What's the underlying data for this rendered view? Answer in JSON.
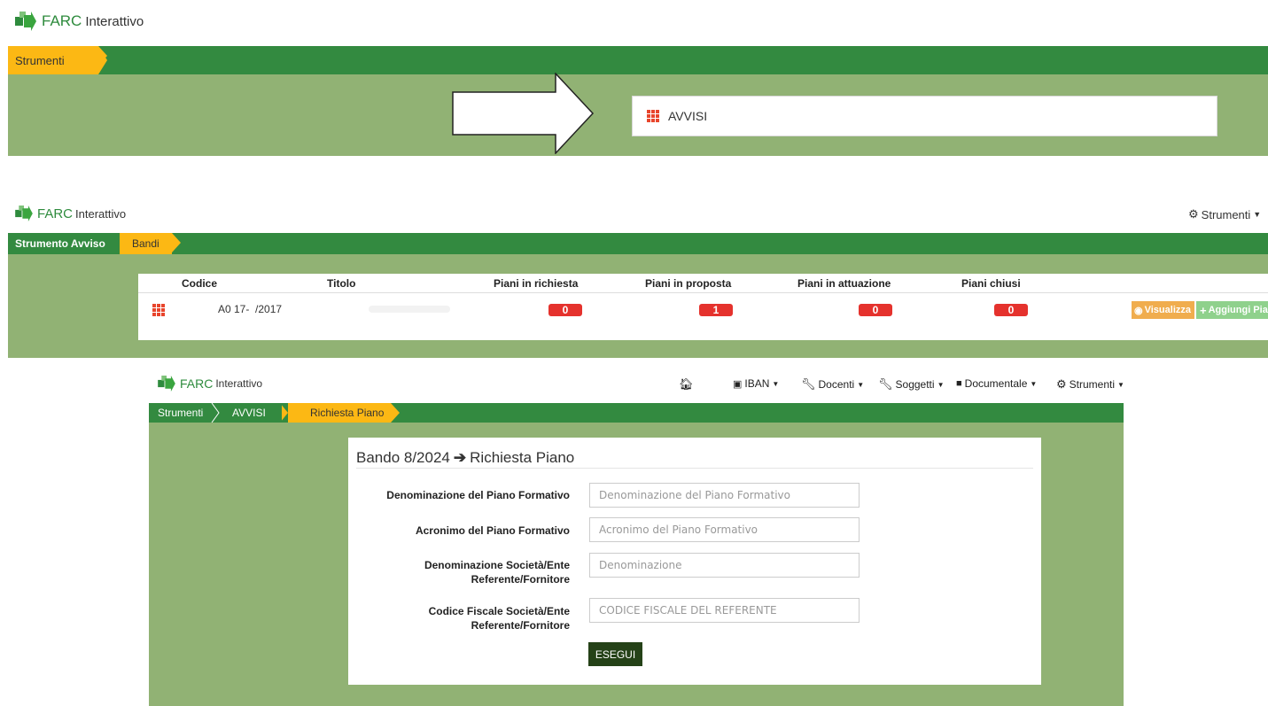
{
  "colors": {
    "green_bar": "#338a40",
    "panel": "#91b274",
    "active_crumb": "#fcb814",
    "badge_red": "#e5322d",
    "brand_green": "#2e8b3d"
  },
  "top_section": {
    "logo": {
      "brand": "FARC",
      "sub": "Interattivo"
    },
    "breadcrumb": [
      "Strumenti"
    ],
    "menu_card": {
      "icon": "grid-icon",
      "label": "AVVISI"
    },
    "arrow": "arrow-right-icon"
  },
  "middle_section": {
    "logo": {
      "brand": "FARC",
      "sub": "Interattivo"
    },
    "strumenti_menu": "Strumenti",
    "breadcrumb": [
      "Strumento Avviso",
      "Bandi"
    ],
    "table": {
      "headers": [
        "Codice",
        "Titolo",
        "Piani in richiesta",
        "Piani in proposta",
        "Piani in attuazione",
        "Piani chiusi"
      ],
      "row": {
        "codice": "A0 17-  /2017",
        "richiesta": "0",
        "proposta": "1",
        "attuazione": "0",
        "chiusi": "0"
      },
      "btn_visualizza": "Visualizza",
      "btn_aggiungi": "Aggiungi Piano"
    }
  },
  "bottom_section": {
    "logo": {
      "brand": "FARC",
      "sub": "Interattivo"
    },
    "nav": {
      "iban": "IBAN",
      "docenti": "Docenti",
      "soggetti": "Soggetti",
      "documentale": "Documentale",
      "strumenti": "Strumenti"
    },
    "breadcrumb": [
      "Strumenti",
      "AVVISI",
      "Richiesta Piano"
    ],
    "form": {
      "title_left": "Bando 8/2024",
      "title_right": "Richiesta Piano",
      "fields": [
        {
          "label_line1": "Denominazione del Piano Formativo",
          "label_line2": "",
          "placeholder": "Denominazione del Piano Formativo"
        },
        {
          "label_line1": "Acronimo del Piano Formativo",
          "label_line2": "",
          "placeholder": "Acronimo del Piano Formativo"
        },
        {
          "label_line1": "Denominazione Società/Ente",
          "label_line2": "Referente/Fornitore",
          "placeholder": "Denominazione"
        },
        {
          "label_line1": "Codice Fiscale Società/Ente",
          "label_line2": "Referente/Fornitore",
          "placeholder": "CODICE FISCALE DEL REFERENTE"
        }
      ],
      "submit": "ESEGUI"
    }
  }
}
